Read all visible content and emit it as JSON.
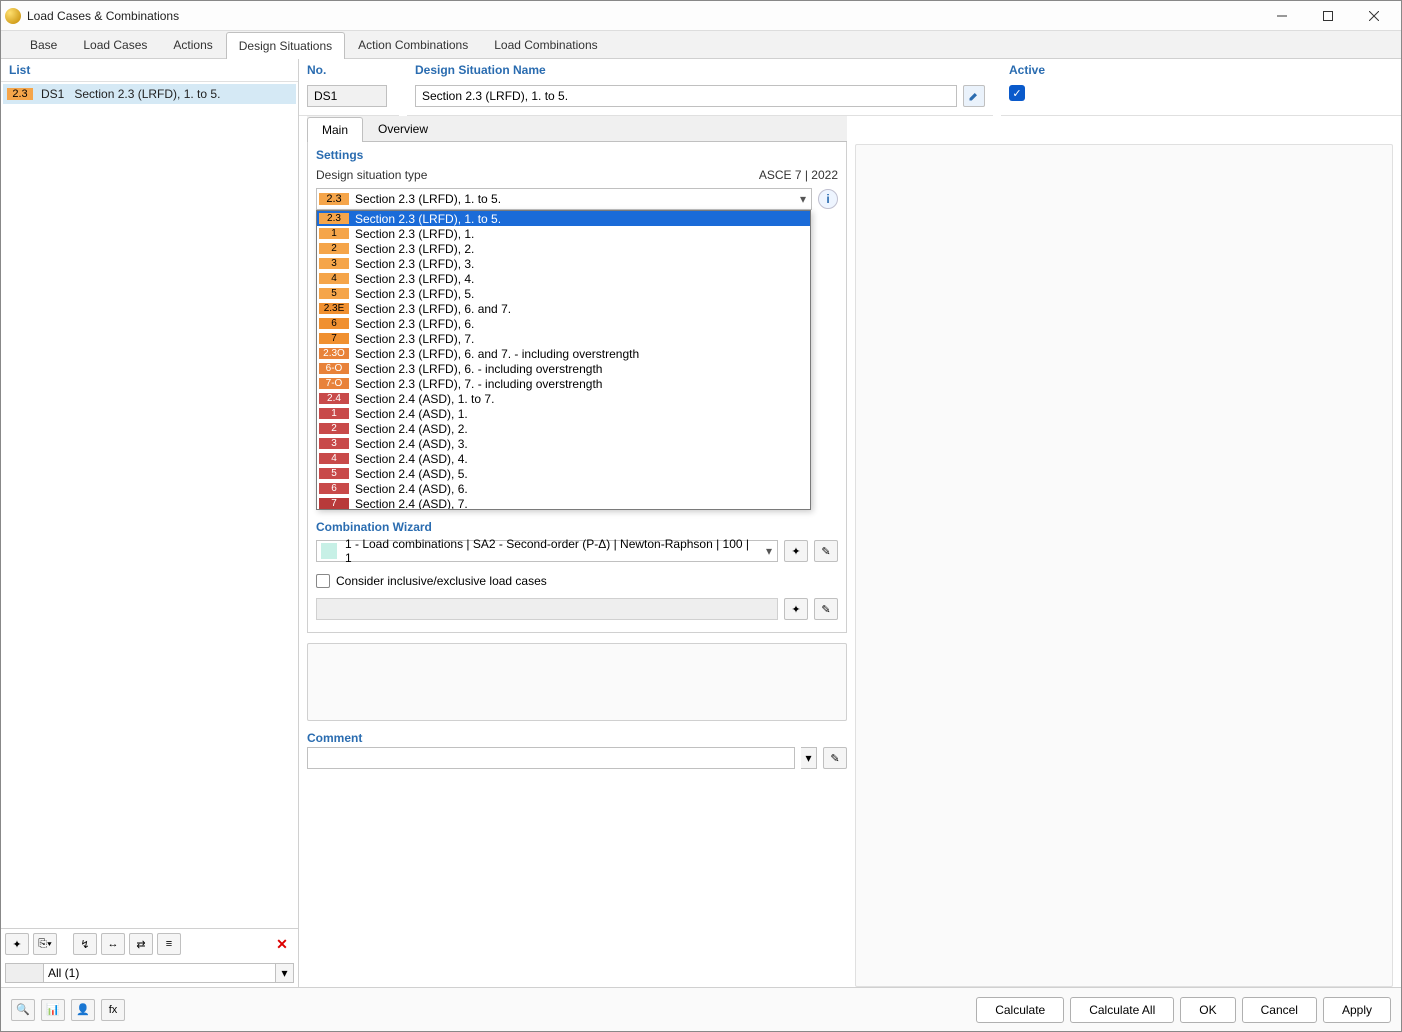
{
  "window": {
    "title": "Load Cases & Combinations"
  },
  "topTabs": [
    "Base",
    "Load Cases",
    "Actions",
    "Design Situations",
    "Action Combinations",
    "Load Combinations"
  ],
  "topTabActive": 3,
  "leftPane": {
    "header": "List",
    "rows": [
      {
        "badge": "2.3",
        "id": "DS1",
        "text": "Section 2.3 (LRFD), 1. to 5."
      }
    ],
    "filter": "All (1)"
  },
  "fields": {
    "noLabel": "No.",
    "noValue": "DS1",
    "nameLabel": "Design Situation Name",
    "nameValue": "Section 2.3 (LRFD), 1. to 5.",
    "activeLabel": "Active"
  },
  "subTabs": [
    "Main",
    "Overview"
  ],
  "subTabActive": 0,
  "settings": {
    "title": "Settings",
    "typeLabel": "Design situation type",
    "standard": "ASCE 7 | 2022",
    "selected": {
      "badge": "2.3",
      "text": "Section 2.3 (LRFD), 1. to 5."
    },
    "options": [
      {
        "badge": "2.3",
        "cls": "orange",
        "text": "Section 2.3 (LRFD), 1. to 5.",
        "sel": true
      },
      {
        "badge": "1",
        "cls": "orange",
        "text": "Section 2.3 (LRFD), 1."
      },
      {
        "badge": "2",
        "cls": "orange",
        "text": "Section 2.3 (LRFD), 2."
      },
      {
        "badge": "3",
        "cls": "orange",
        "text": "Section 2.3 (LRFD), 3."
      },
      {
        "badge": "4",
        "cls": "orange",
        "text": "Section 2.3 (LRFD), 4."
      },
      {
        "badge": "5",
        "cls": "orange",
        "text": "Section 2.3 (LRFD), 5."
      },
      {
        "badge": "2.3E",
        "cls": "orange2",
        "text": "Section 2.3 (LRFD), 6. and 7."
      },
      {
        "badge": "6",
        "cls": "orange2",
        "text": "Section 2.3 (LRFD), 6."
      },
      {
        "badge": "7",
        "cls": "orange2",
        "text": "Section 2.3 (LRFD), 7."
      },
      {
        "badge": "2.3O",
        "cls": "orange3",
        "text": "Section 2.3 (LRFD), 6. and 7. - including overstrength"
      },
      {
        "badge": "6-O",
        "cls": "orange3",
        "text": "Section 2.3 (LRFD), 6. - including overstrength"
      },
      {
        "badge": "7-O",
        "cls": "orange3",
        "text": "Section 2.3 (LRFD), 7. - including overstrength"
      },
      {
        "badge": "2.4",
        "cls": "red",
        "text": "Section 2.4 (ASD), 1. to 7."
      },
      {
        "badge": "1",
        "cls": "red",
        "text": "Section 2.4 (ASD), 1."
      },
      {
        "badge": "2",
        "cls": "red",
        "text": "Section 2.4 (ASD), 2."
      },
      {
        "badge": "3",
        "cls": "red",
        "text": "Section 2.4 (ASD), 3."
      },
      {
        "badge": "4",
        "cls": "red",
        "text": "Section 2.4 (ASD), 4."
      },
      {
        "badge": "5",
        "cls": "red",
        "text": "Section 2.4 (ASD), 5."
      },
      {
        "badge": "6",
        "cls": "red",
        "text": "Section 2.4 (ASD), 6."
      },
      {
        "badge": "7",
        "cls": "red2",
        "text": "Section 2.4 (ASD), 7."
      }
    ]
  },
  "wizard": {
    "title": "Combination Wizard",
    "value": "1 - Load combinations | SA2 - Second-order (P-Δ) | Newton-Raphson | 100 | 1",
    "considerLabel": "Consider inclusive/exclusive load cases"
  },
  "comment": {
    "title": "Comment"
  },
  "footer": {
    "calculate": "Calculate",
    "calculateAll": "Calculate All",
    "ok": "OK",
    "cancel": "Cancel",
    "apply": "Apply"
  }
}
